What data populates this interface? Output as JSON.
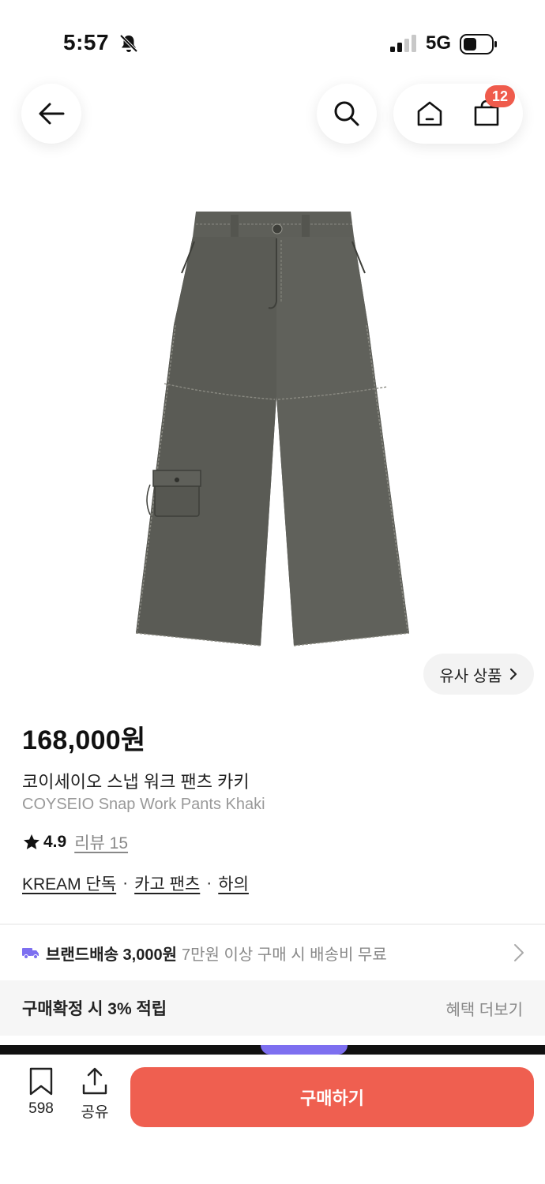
{
  "status_bar": {
    "time": "5:57",
    "network": "5G"
  },
  "nav": {
    "cart_count": "12"
  },
  "similar": {
    "label": "유사 상품"
  },
  "product": {
    "price": "168,000원",
    "name_ko": "코이세이오 스냅 워크 팬츠 카키",
    "name_en": "COYSEIO Snap Work Pants Khaki",
    "rating": "4.9",
    "review_label": "리뷰 15",
    "tags": [
      "KREAM 단독",
      "카고 팬츠",
      "하의"
    ],
    "tag_separator": "·"
  },
  "shipping": {
    "main": "브랜드배송 3,000원",
    "sub": "7만원 이상 구매 시 배송비 무료"
  },
  "points": {
    "text": "구매확정 시 3% 적립",
    "link": "혜택 더보기"
  },
  "bottom_bar": {
    "bookmark_count": "598",
    "share_label": "공유",
    "buy_label": "구매하기"
  },
  "colors": {
    "accent": "#ef5f50",
    "badge": "#ef5b4c",
    "truck": "#7d6ff0",
    "pants": "#5a5b55"
  },
  "icons": [
    "bell-slash-icon",
    "signal-icon",
    "battery-icon",
    "back-arrow-icon",
    "search-icon",
    "home-icon",
    "cart-icon",
    "star-icon",
    "truck-icon",
    "chevron-right-icon",
    "bookmark-icon",
    "share-icon"
  ]
}
